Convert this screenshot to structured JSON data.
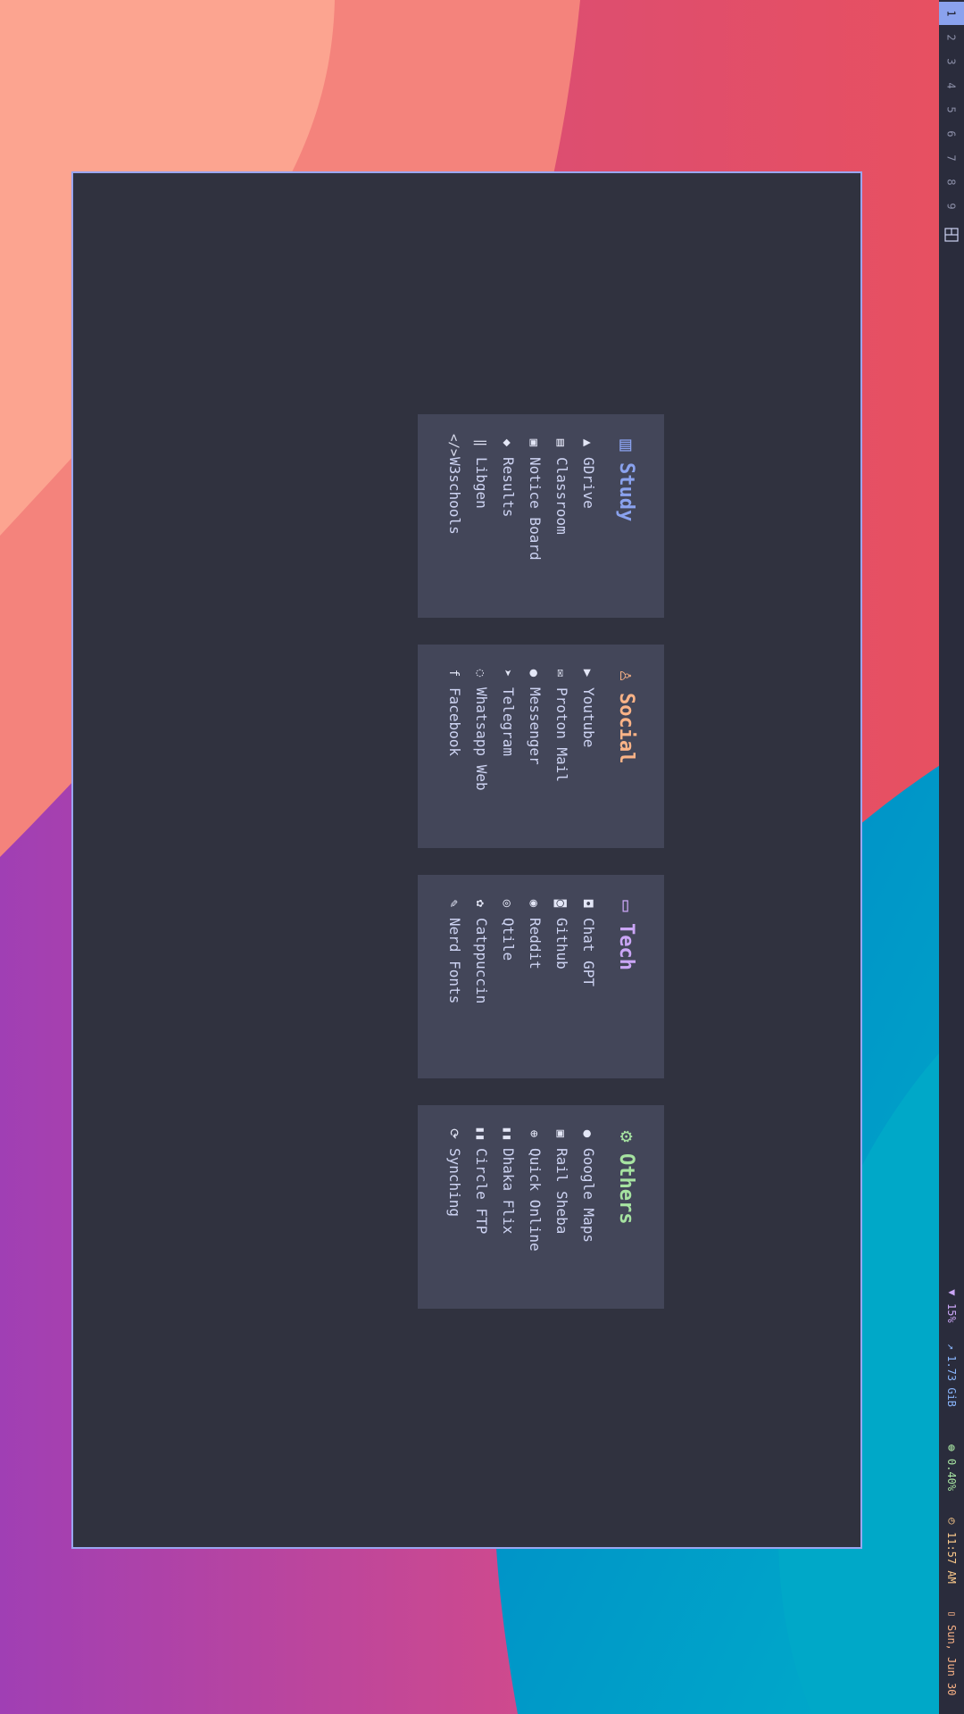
{
  "bar": {
    "workspaces": [
      "1",
      "2",
      "3",
      "4",
      "5",
      "6",
      "7",
      "8",
      "9"
    ],
    "active_workspace": "1",
    "volume": "15%",
    "memory": "1.73 GiB",
    "cpu": "0.40%",
    "time": "11:57 AM",
    "date": "Sun, Jun 30"
  },
  "colors": {
    "accent": "#8aa2ee",
    "study": "#8aa2ee",
    "social": "#fab387",
    "tech": "#cba6f7",
    "others": "#a6e3a1",
    "window_bg": "#30323f",
    "card_bg": "#434659"
  },
  "sections": [
    {
      "title": "Study",
      "icon": "book-icon",
      "items": [
        {
          "label": "GDrive",
          "icon": "gdrive-icon"
        },
        {
          "label": "Classroom",
          "icon": "classroom-icon"
        },
        {
          "label": "Notice Board",
          "icon": "notice-board-icon"
        },
        {
          "label": "Results",
          "icon": "graduation-cap-icon"
        },
        {
          "label": "Libgen",
          "icon": "library-icon"
        },
        {
          "label": "W3schools",
          "icon": "code-icon"
        }
      ]
    },
    {
      "title": "Social",
      "icon": "people-icon",
      "items": [
        {
          "label": "Youtube",
          "icon": "youtube-icon"
        },
        {
          "label": "Proton Mail",
          "icon": "mail-icon"
        },
        {
          "label": "Messenger",
          "icon": "messenger-icon"
        },
        {
          "label": "Telegram",
          "icon": "telegram-icon"
        },
        {
          "label": "Whatsapp Web",
          "icon": "whatsapp-icon"
        },
        {
          "label": "Facebook",
          "icon": "facebook-icon"
        }
      ]
    },
    {
      "title": "Tech",
      "icon": "laptop-icon",
      "items": [
        {
          "label": "Chat GPT",
          "icon": "robot-icon"
        },
        {
          "label": "Github",
          "icon": "github-icon"
        },
        {
          "label": "Reddit",
          "icon": "reddit-icon"
        },
        {
          "label": "Qtile",
          "icon": "qtile-icon"
        },
        {
          "label": "Catppuccin",
          "icon": "palette-icon"
        },
        {
          "label": "Nerd Fonts",
          "icon": "nerd-fonts-icon"
        }
      ]
    },
    {
      "title": "Others",
      "icon": "gear-icon",
      "items": [
        {
          "label": "Google Maps",
          "icon": "map-pin-icon"
        },
        {
          "label": "Rail Sheba",
          "icon": "train-icon"
        },
        {
          "label": "Quick Online",
          "icon": "globe-icon"
        },
        {
          "label": "Dhaka Flix",
          "icon": "film-icon"
        },
        {
          "label": "Circle FTP",
          "icon": "film-icon"
        },
        {
          "label": "Synching",
          "icon": "sync-icon"
        }
      ]
    }
  ]
}
